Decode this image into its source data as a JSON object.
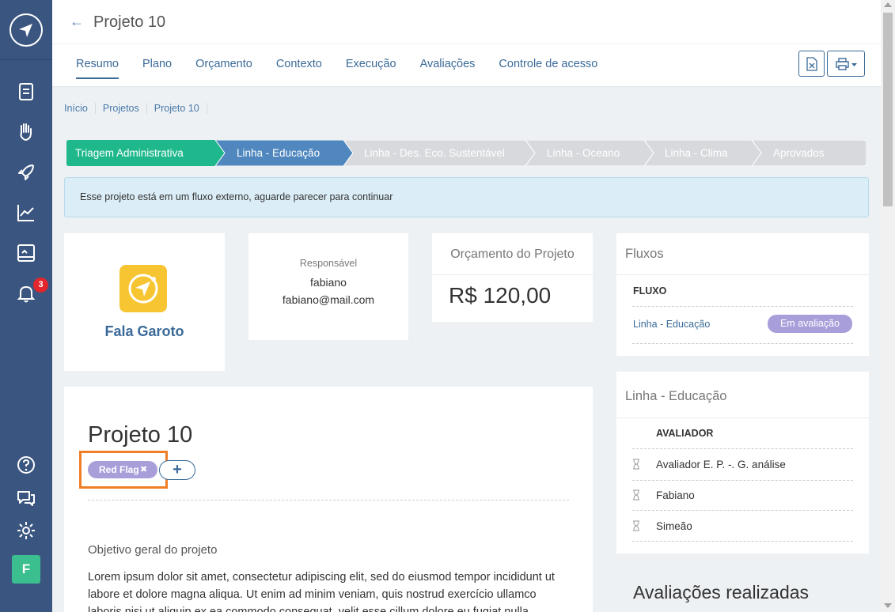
{
  "sidebar": {
    "items": [
      {
        "icon": "document-icon"
      },
      {
        "icon": "hand-heart-icon"
      },
      {
        "icon": "rocket-icon"
      },
      {
        "icon": "chart-line-icon"
      },
      {
        "icon": "board-image-icon"
      },
      {
        "icon": "bell-icon"
      }
    ],
    "notification_count": "3",
    "bottom": [
      {
        "icon": "help-icon"
      },
      {
        "icon": "chat-icon"
      },
      {
        "icon": "gear-icon"
      }
    ],
    "avatar_initial": "F"
  },
  "header": {
    "title": "Projeto 10",
    "tabs": [
      "Resumo",
      "Plano",
      "Orçamento",
      "Contexto",
      "Execução",
      "Avaliações",
      "Controle de acesso"
    ],
    "active_tab": "Resumo",
    "buttons": [
      {
        "icon": "excel-file-icon"
      },
      {
        "icon": "printer-icon"
      }
    ]
  },
  "breadcrumb": [
    "Início",
    "Projetos",
    "Projeto 10"
  ],
  "pipeline": {
    "stages": [
      "Triagem Administrativa",
      "Linha - Educação",
      "Linha - Des. Eco. Sustentável",
      "Linha - Oceano",
      "Linha - Clima",
      "Aprovados"
    ],
    "colors": {
      "done": "#1fb88d",
      "current": "#4f87be",
      "pending": "#d7d9dc"
    }
  },
  "info_message": "Esse projeto está em um fluxo externo, aguarde parecer para continuar",
  "organization": {
    "name": "Fala Garoto"
  },
  "responsavel": {
    "label": "Responsável",
    "name": "fabiano",
    "email": "fabiano@mail.com"
  },
  "budget": {
    "label": "Orçamento do Projeto",
    "value": "R$ 120,00"
  },
  "fluxos": {
    "title": "Fluxos",
    "header": "FLUXO",
    "rows": [
      {
        "name": "Linha - Educação",
        "status": "Em avaliação"
      }
    ]
  },
  "linha": {
    "title": "Linha - Educação",
    "header": "AVALIADOR",
    "rows": [
      "Avaliador E. P. -. G. análise",
      "Fabiano",
      "Simeão"
    ]
  },
  "project": {
    "title": "Projeto 10",
    "tag": "Red Flag",
    "add_label": "+",
    "section_title": "Objetivo geral do projeto",
    "description": "Lorem ipsum dolor sit amet, consectetur adipiscing elit, sed do eiusmod tempor incididunt ut labore et dolore magna aliqua. Ut enim ad minim veniam, quis nostrud exercício ullamco laboris nisi ut aliquip ex ea commodo consequat, velit esse cillum dolore eu fugiat nulla"
  },
  "avaliacoes": {
    "title": "Avaliações realizadas"
  }
}
